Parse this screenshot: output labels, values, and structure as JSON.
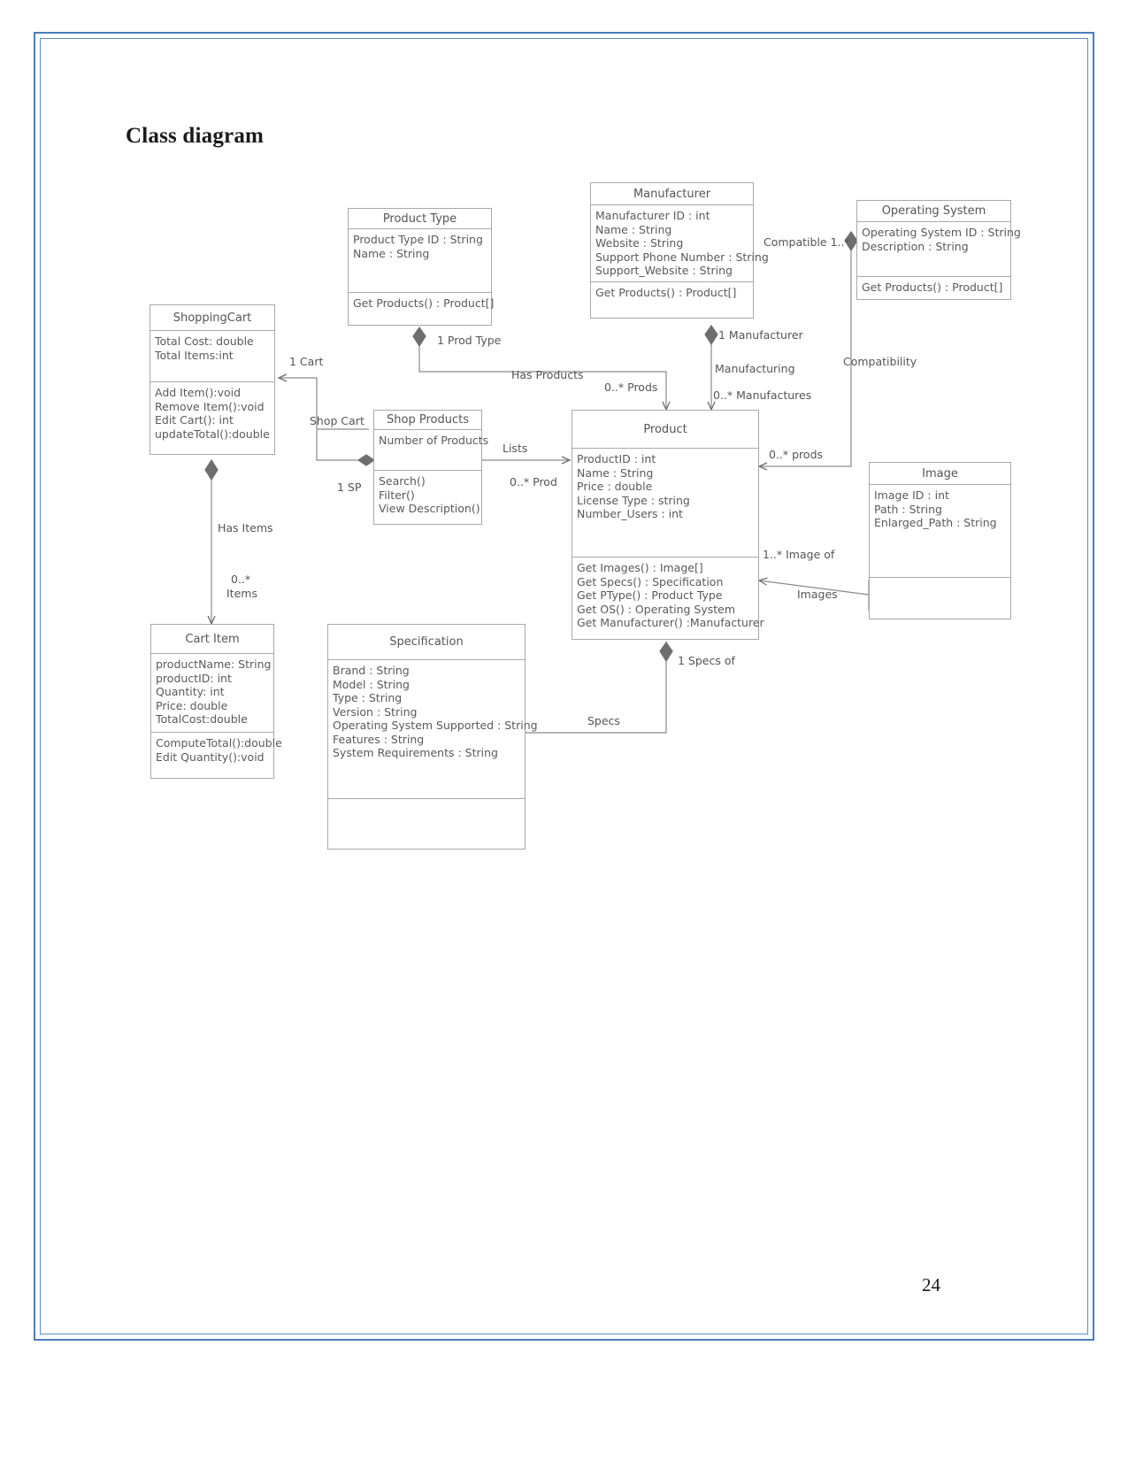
{
  "document": {
    "title": "Class diagram",
    "page_number": "24",
    "border_color": "#4a7ebb"
  },
  "classes": [
    {
      "id": "product-type",
      "name": "Product Type",
      "attributes": [
        "Product Type ID : String",
        "Name : String"
      ],
      "operations": [
        "Get Products() : Product[]"
      ]
    },
    {
      "id": "manufacturer",
      "name": "Manufacturer",
      "attributes": [
        "Manufacturer ID : int",
        "Name : String",
        "Website : String",
        "Support Phone Number : String",
        "Support_Website : String"
      ],
      "operations": [
        "Get Products() : Product[]"
      ]
    },
    {
      "id": "operating-system",
      "name": "Operating System",
      "attributes": [
        "Operating System ID : String",
        "Description : String"
      ],
      "operations": [
        "Get Products() : Product[]"
      ]
    },
    {
      "id": "shoppingcart",
      "name": "ShoppingCart",
      "attributes": [
        "Total Cost: double",
        "Total Items:int"
      ],
      "operations": [
        "Add Item():void",
        "Remove Item():void",
        "Edit Cart(): int",
        "updateTotal():double"
      ]
    },
    {
      "id": "shop-products",
      "name": "Shop Products",
      "attributes": [
        "Number of Products"
      ],
      "operations": [
        "Search()",
        "Filter()",
        "View Description()"
      ]
    },
    {
      "id": "product",
      "name": "Product",
      "attributes": [
        "ProductID : int",
        "Name : String",
        "Price : double",
        "License Type : string",
        "Number_Users : int"
      ],
      "operations": [
        "Get Images() : Image[]",
        "Get Specs() : Specification",
        "Get PType() : Product Type",
        "Get OS() : Operating System",
        "Get Manufacturer() :Manufacturer"
      ]
    },
    {
      "id": "image",
      "name": "Image",
      "attributes": [
        "Image ID : int",
        "Path : String",
        "Enlarged_Path : String"
      ],
      "operations": []
    },
    {
      "id": "cart-item",
      "name": "Cart Item",
      "attributes": [
        "productName: String",
        "productID: int",
        "Quantity: int",
        "Price: double",
        "TotalCost:double"
      ],
      "operations": [
        "ComputeTotal():double",
        "Edit Quantity():void"
      ]
    },
    {
      "id": "specification",
      "name": "Specification",
      "attributes": [
        "Brand : String",
        "Model : String",
        "Type : String",
        "Version : String",
        "Operating System Supported : String",
        "Features : String",
        "System Requirements : String"
      ],
      "operations": []
    }
  ],
  "relationships": [
    {
      "id": "prod-type-role",
      "label": "1 Prod Type"
    },
    {
      "id": "has-products",
      "label": "Has Products"
    },
    {
      "id": "prods-mult",
      "label": "0..* Prods"
    },
    {
      "id": "manufacturer-role",
      "label": "1 Manufacturer"
    },
    {
      "id": "manufacturing",
      "label": "Manufacturing"
    },
    {
      "id": "manufactures-mult",
      "label": "0..* Manufactures"
    },
    {
      "id": "compatible",
      "label": "Compatible 1..*"
    },
    {
      "id": "compatibility",
      "label": "Compatibility"
    },
    {
      "id": "cart-role",
      "label": "1 Cart"
    },
    {
      "id": "shop-cart",
      "label": "Shop Cart"
    },
    {
      "id": "sp-role",
      "label": "1 SP"
    },
    {
      "id": "lists",
      "label": "Lists"
    },
    {
      "id": "prod-mult",
      "label": "0..* Prod"
    },
    {
      "id": "has-items",
      "label": "Has Items"
    },
    {
      "id": "items-mult-1",
      "label": "0..*"
    },
    {
      "id": "items-mult-2",
      "label": "Items"
    },
    {
      "id": "prods-lower",
      "label": "0..* prods"
    },
    {
      "id": "image-of",
      "label": "1..* Image of"
    },
    {
      "id": "images",
      "label": "Images"
    },
    {
      "id": "specs-of",
      "label": "1 Specs of"
    },
    {
      "id": "specs",
      "label": "Specs"
    }
  ]
}
